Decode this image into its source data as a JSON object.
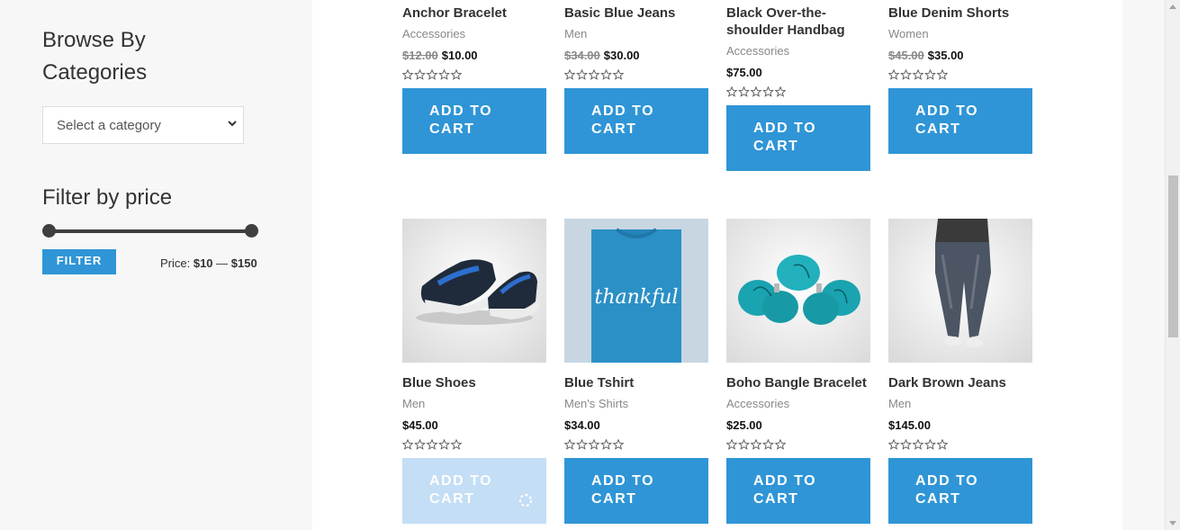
{
  "sidebar": {
    "categories_title": "Browse By Categories",
    "category_select_value": "Select a category",
    "price_title": "Filter by price",
    "filter_label": "FILTER",
    "price_prefix": "Price: ",
    "price_min": "$10",
    "price_sep": " — ",
    "price_max": "$150"
  },
  "add_to_cart_label": "ADD TO CART",
  "products": [
    {
      "name": "Anchor Bracelet",
      "category": "Accessories",
      "old_price": "$12.00",
      "price": "$10.00",
      "rating": 0
    },
    {
      "name": "Basic Blue Jeans",
      "category": "Men",
      "old_price": "$34.00",
      "price": "$30.00",
      "rating": 0
    },
    {
      "name": "Black Over-the-shoulder Handbag",
      "category": "Accessories",
      "old_price": "",
      "price": "$75.00",
      "rating": 0
    },
    {
      "name": "Blue Denim Shorts",
      "category": "Women",
      "old_price": "$45.00",
      "price": "$35.00",
      "rating": 0
    },
    {
      "name": "Blue Shoes",
      "category": "Men",
      "old_price": "",
      "price": "$45.00",
      "rating": 0,
      "loading": true
    },
    {
      "name": "Blue Tshirt",
      "category": "Men's Shirts",
      "old_price": "",
      "price": "$34.00",
      "rating": 0,
      "shirt_text": "thankful"
    },
    {
      "name": "Boho Bangle Bracelet",
      "category": "Accessories",
      "old_price": "",
      "price": "$25.00",
      "rating": 0
    },
    {
      "name": "Dark Brown Jeans",
      "category": "Men",
      "old_price": "",
      "price": "$145.00",
      "rating": 0
    }
  ],
  "colors": {
    "accent": "#2f95d6",
    "loading": "#c3def5"
  }
}
